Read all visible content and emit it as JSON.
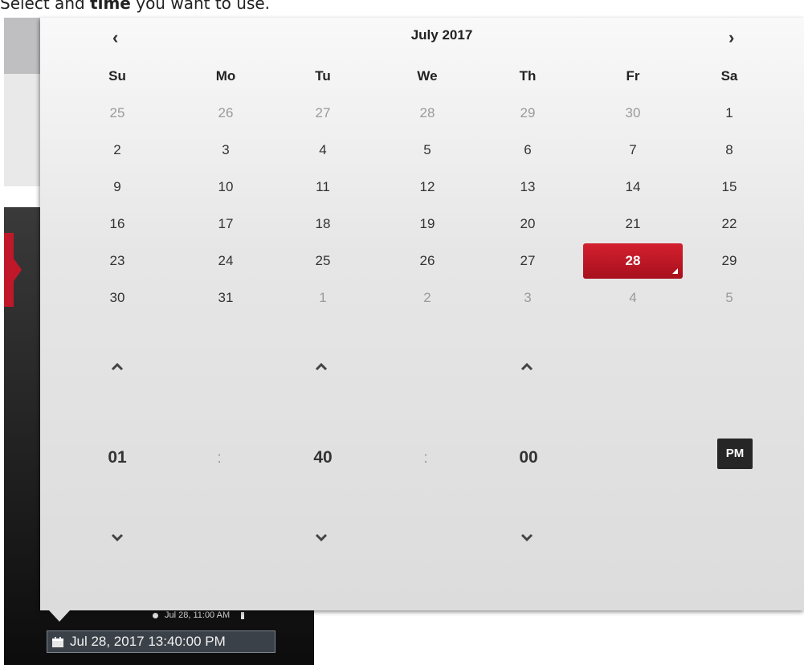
{
  "instruction": {
    "prefix": "Select and ",
    "bold": "time",
    "suffix": " you want to use."
  },
  "background": {
    "event_time": "Jul 28, 11:00 AM",
    "datetime_value": "Jul 28, 2017 13:40:00 PM"
  },
  "picker": {
    "prev": "‹",
    "next": "›",
    "month_label": "July 2017",
    "weekdays": [
      "Su",
      "Mo",
      "Tu",
      "We",
      "Th",
      "Fr",
      "Sa"
    ],
    "weeks": [
      [
        {
          "d": "25",
          "m": true
        },
        {
          "d": "26",
          "m": true
        },
        {
          "d": "27",
          "m": true
        },
        {
          "d": "28",
          "m": true
        },
        {
          "d": "29",
          "m": true
        },
        {
          "d": "30",
          "m": true
        },
        {
          "d": "1",
          "m": false
        }
      ],
      [
        {
          "d": "2",
          "m": false
        },
        {
          "d": "3",
          "m": false
        },
        {
          "d": "4",
          "m": false
        },
        {
          "d": "5",
          "m": false
        },
        {
          "d": "6",
          "m": false
        },
        {
          "d": "7",
          "m": false
        },
        {
          "d": "8",
          "m": false
        }
      ],
      [
        {
          "d": "9",
          "m": false
        },
        {
          "d": "10",
          "m": false
        },
        {
          "d": "11",
          "m": false
        },
        {
          "d": "12",
          "m": false
        },
        {
          "d": "13",
          "m": false
        },
        {
          "d": "14",
          "m": false
        },
        {
          "d": "15",
          "m": false
        }
      ],
      [
        {
          "d": "16",
          "m": false
        },
        {
          "d": "17",
          "m": false
        },
        {
          "d": "18",
          "m": false
        },
        {
          "d": "19",
          "m": false
        },
        {
          "d": "20",
          "m": false
        },
        {
          "d": "21",
          "m": false
        },
        {
          "d": "22",
          "m": false
        }
      ],
      [
        {
          "d": "23",
          "m": false
        },
        {
          "d": "24",
          "m": false
        },
        {
          "d": "25",
          "m": false
        },
        {
          "d": "26",
          "m": false
        },
        {
          "d": "27",
          "m": false
        },
        {
          "d": "28",
          "m": false,
          "selected": true
        },
        {
          "d": "29",
          "m": false
        }
      ],
      [
        {
          "d": "30",
          "m": false
        },
        {
          "d": "31",
          "m": false
        },
        {
          "d": "1",
          "m": true
        },
        {
          "d": "2",
          "m": true
        },
        {
          "d": "3",
          "m": true
        },
        {
          "d": "4",
          "m": true
        },
        {
          "d": "5",
          "m": true
        }
      ]
    ],
    "time": {
      "hours": "01",
      "minutes": "40",
      "seconds": "00",
      "separator": ":",
      "period": "PM"
    }
  },
  "colors": {
    "selected": "#c0182a",
    "period_bg": "#262626"
  }
}
